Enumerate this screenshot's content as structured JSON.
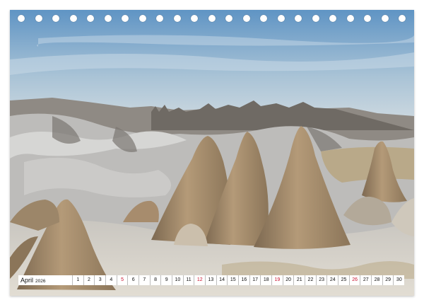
{
  "calendar": {
    "month": "April",
    "year": "2026",
    "days": [
      {
        "n": "1",
        "sun": false
      },
      {
        "n": "2",
        "sun": false
      },
      {
        "n": "3",
        "sun": false
      },
      {
        "n": "4",
        "sun": false
      },
      {
        "n": "5",
        "sun": true
      },
      {
        "n": "6",
        "sun": false
      },
      {
        "n": "7",
        "sun": false
      },
      {
        "n": "8",
        "sun": false
      },
      {
        "n": "9",
        "sun": false
      },
      {
        "n": "10",
        "sun": false
      },
      {
        "n": "11",
        "sun": false
      },
      {
        "n": "12",
        "sun": true
      },
      {
        "n": "13",
        "sun": false
      },
      {
        "n": "14",
        "sun": false
      },
      {
        "n": "15",
        "sun": false
      },
      {
        "n": "16",
        "sun": false
      },
      {
        "n": "17",
        "sun": false
      },
      {
        "n": "18",
        "sun": false
      },
      {
        "n": "19",
        "sun": true
      },
      {
        "n": "20",
        "sun": false
      },
      {
        "n": "21",
        "sun": false
      },
      {
        "n": "22",
        "sun": false
      },
      {
        "n": "23",
        "sun": false
      },
      {
        "n": "24",
        "sun": false
      },
      {
        "n": "25",
        "sun": false
      },
      {
        "n": "26",
        "sun": true
      },
      {
        "n": "27",
        "sun": false
      },
      {
        "n": "28",
        "sun": false
      },
      {
        "n": "29",
        "sun": false
      },
      {
        "n": "30",
        "sun": false
      }
    ],
    "sunday_color": "#c8102e",
    "ring_count": 23
  },
  "photo": {
    "subject": "cappadocia-fairy-chimneys",
    "sky_top": "#5f94c4",
    "sky_bottom": "#cfdbe3",
    "rock_color": "#a78c6d",
    "tuff_color": "#cfcfcf"
  }
}
